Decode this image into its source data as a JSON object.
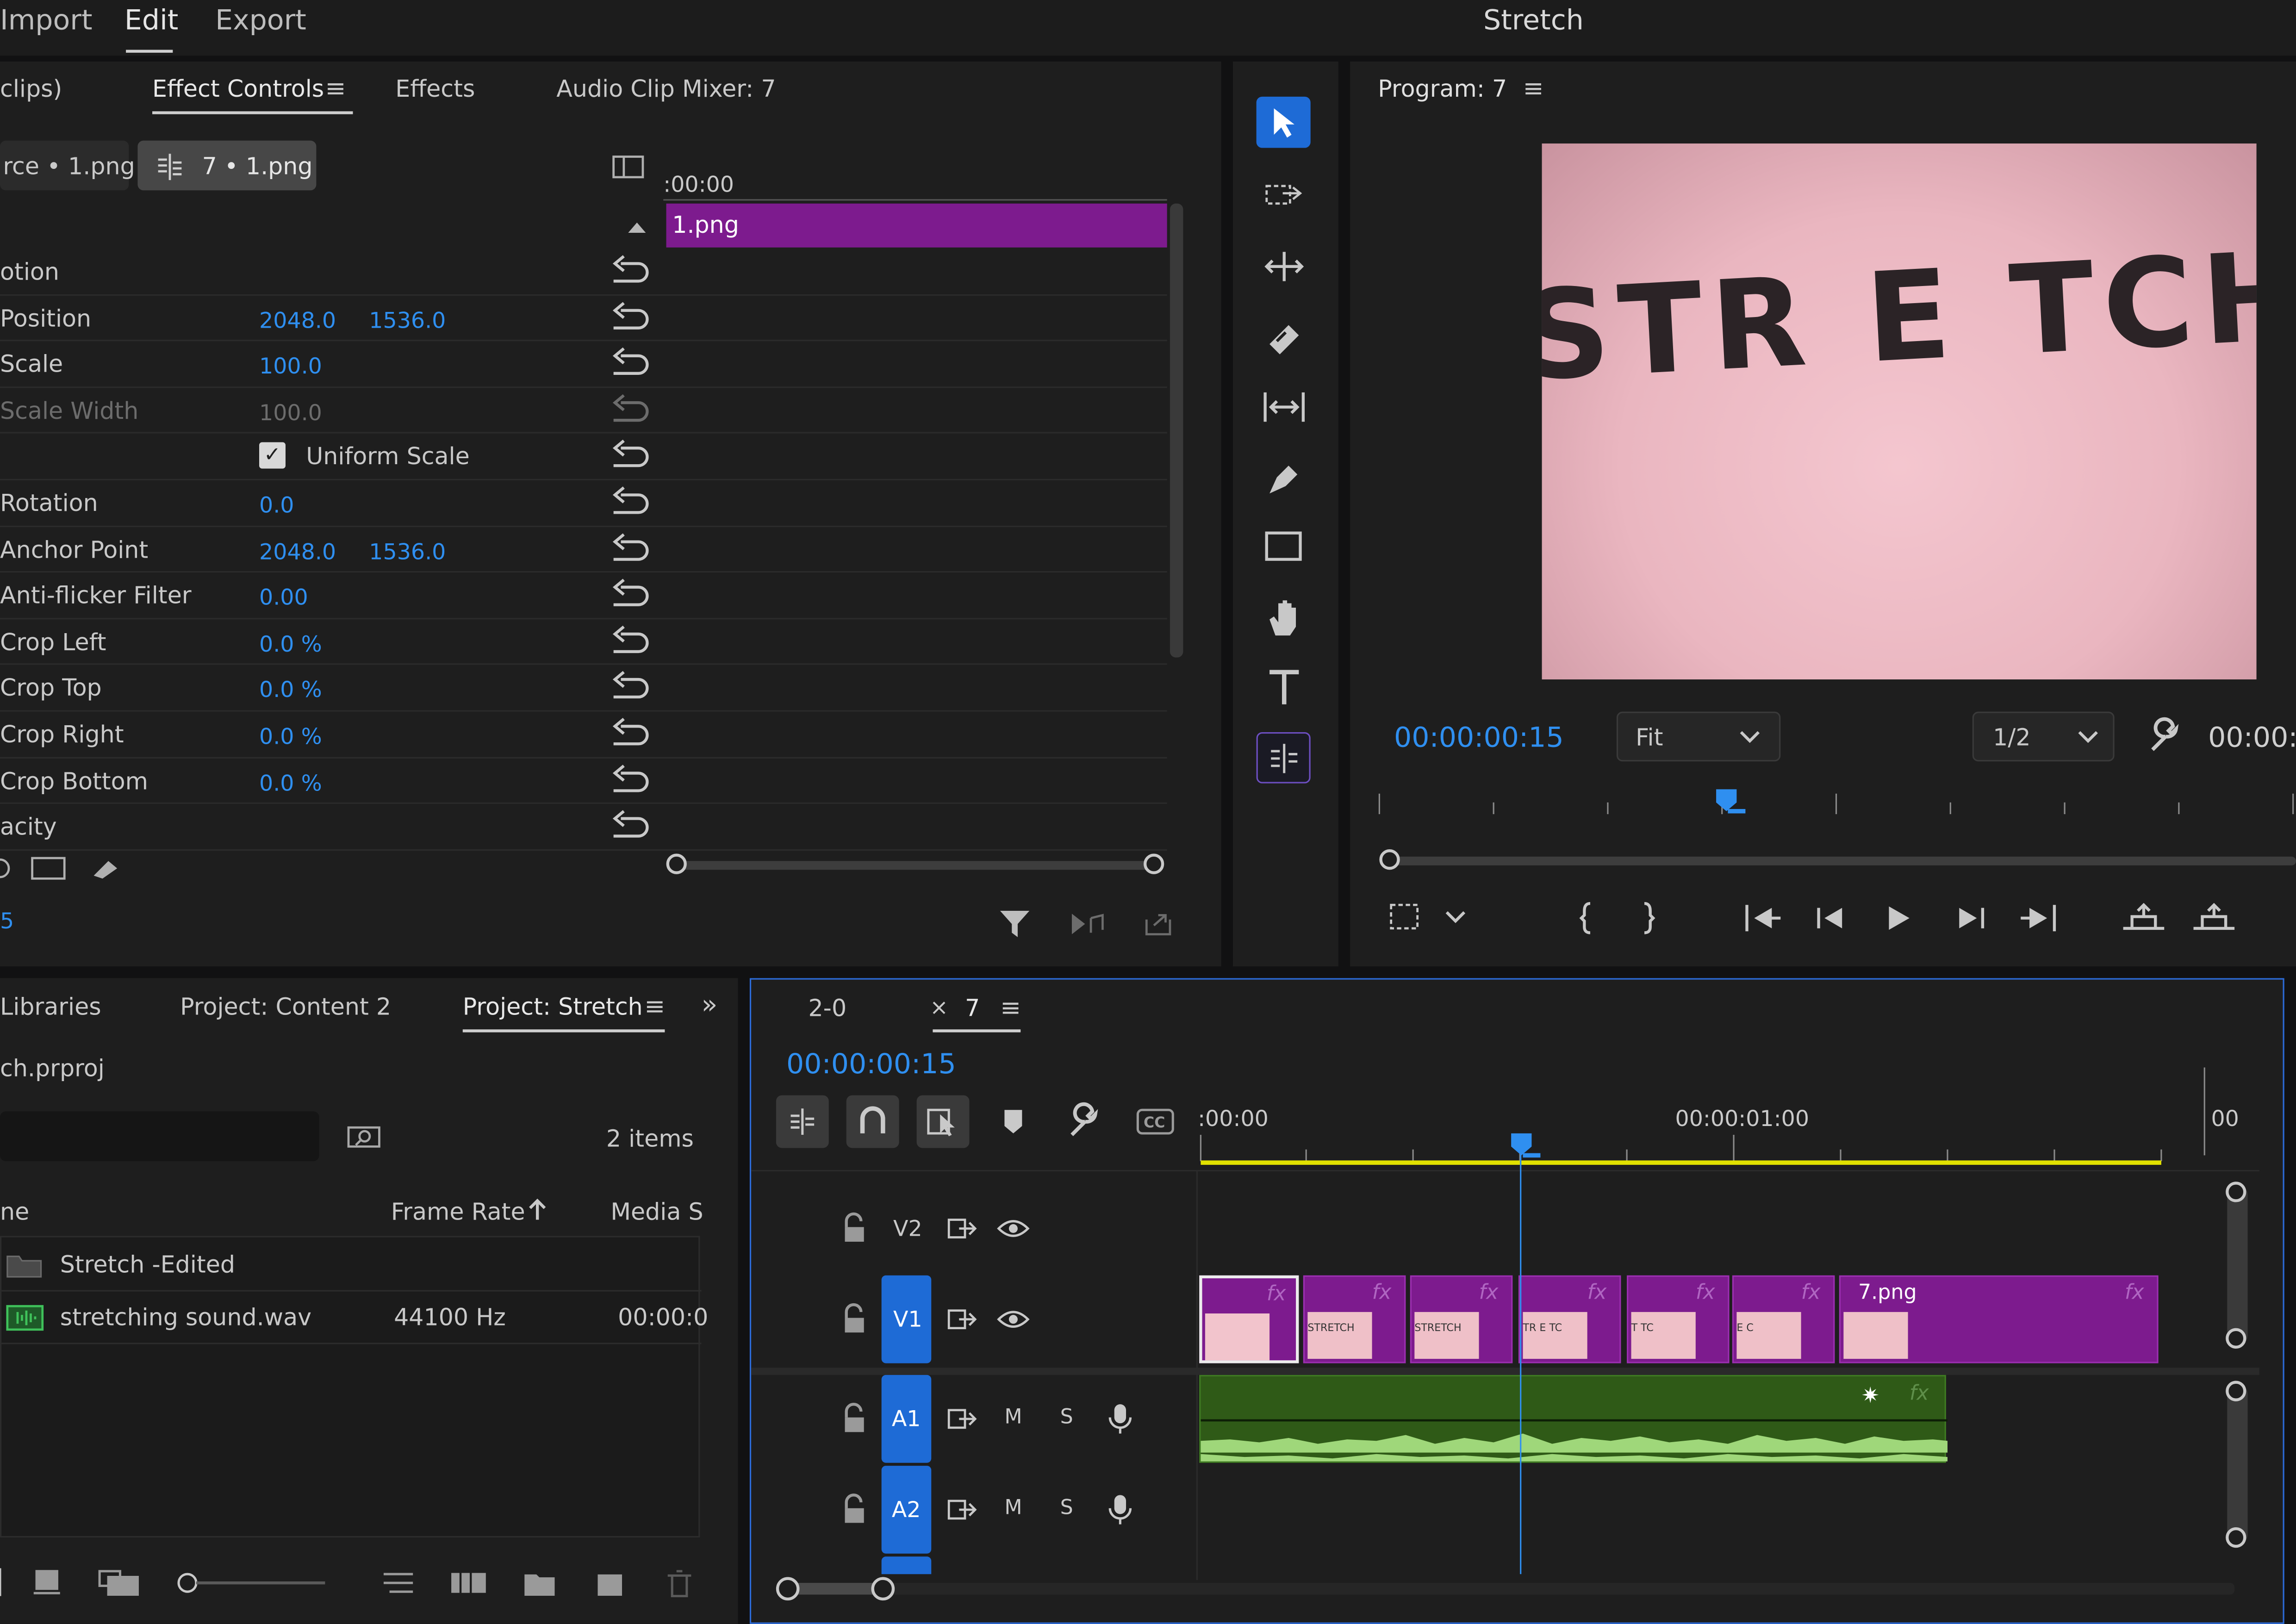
{
  "menu": {
    "items": [
      "Import",
      "Edit",
      "Export"
    ],
    "active": "Edit",
    "title": "Stretch"
  },
  "effect_panel": {
    "tabs": [
      "clips)",
      "Effect Controls",
      "Effects",
      "Audio Clip Mixer: 7"
    ],
    "source_label": "rce • 1.png",
    "sequence_label": "7 • 1.png",
    "timecode_start": ":00:00",
    "clip_name": "1.png",
    "bottom_timecode": "5",
    "properties": [
      {
        "name": "otion",
        "v1": "",
        "v2": ""
      },
      {
        "name": "Position",
        "v1": "2048.0",
        "v2": "1536.0"
      },
      {
        "name": "Scale",
        "v1": "100.0",
        "v2": ""
      },
      {
        "name": "Scale Width",
        "v1": "100.0",
        "v2": ""
      },
      {
        "name": "",
        "v1": "",
        "v2": ""
      },
      {
        "name": "Rotation",
        "v1": "0.0",
        "v2": ""
      },
      {
        "name": "Anchor Point",
        "v1": "2048.0",
        "v2": "1536.0"
      },
      {
        "name": "Anti-flicker Filter",
        "v1": "0.00",
        "v2": ""
      },
      {
        "name": "Crop Left",
        "v1": "0.0 %",
        "v2": ""
      },
      {
        "name": "Crop Top",
        "v1": "0.0 %",
        "v2": ""
      },
      {
        "name": "Crop Right",
        "v1": "0.0 %",
        "v2": ""
      },
      {
        "name": "Crop Bottom",
        "v1": "0.0 %",
        "v2": ""
      },
      {
        "name": "acity",
        "v1": "",
        "v2": ""
      }
    ],
    "uniform_scale_label": "Uniform Scale",
    "uniform_scale_checked": true
  },
  "program": {
    "title": "Program: 7",
    "preview_text": "STR E TCH",
    "timecode": "00:00:00:15",
    "fit_label": "Fit",
    "resolution_label": "1/2",
    "end_timecode": "00:00:"
  },
  "project_panel": {
    "tabs": [
      "Libraries",
      "Project: Content 2",
      "Project: Stretch"
    ],
    "active_tab": "Project: Stretch",
    "file_name": "ch.prproj",
    "items_count": "2 items",
    "columns": [
      "ne",
      "Frame Rate",
      "Media S"
    ],
    "rows": [
      {
        "name": "Stretch -Edited",
        "type": "folder",
        "frame_rate": "",
        "media": ""
      },
      {
        "name": "stretching sound.wav",
        "type": "audio",
        "frame_rate": "44100 Hz",
        "media": "00:00:0"
      }
    ]
  },
  "timeline": {
    "tabs": [
      "2-0",
      "7"
    ],
    "active_tab": "7",
    "timecode": "00:00:00:15",
    "ruler_labels": [
      ":00:00",
      "00:00:01:00",
      "00"
    ],
    "tracks": [
      {
        "id": "V2",
        "kind": "video"
      },
      {
        "id": "V1",
        "kind": "video"
      },
      {
        "id": "A1",
        "kind": "audio"
      },
      {
        "id": "A2",
        "kind": "audio"
      }
    ],
    "audio_buttons": [
      "M",
      "S"
    ],
    "clip_label": "7.png",
    "fx_label": "fx",
    "playhead_fraction": 0.33
  },
  "colors": {
    "accent_blue": "#2f8ff0",
    "clip_purple": "#7d1b8e",
    "audio_green": "#2f5a17",
    "track_blue": "#1e6bd6",
    "work_area": "#e1e100"
  }
}
